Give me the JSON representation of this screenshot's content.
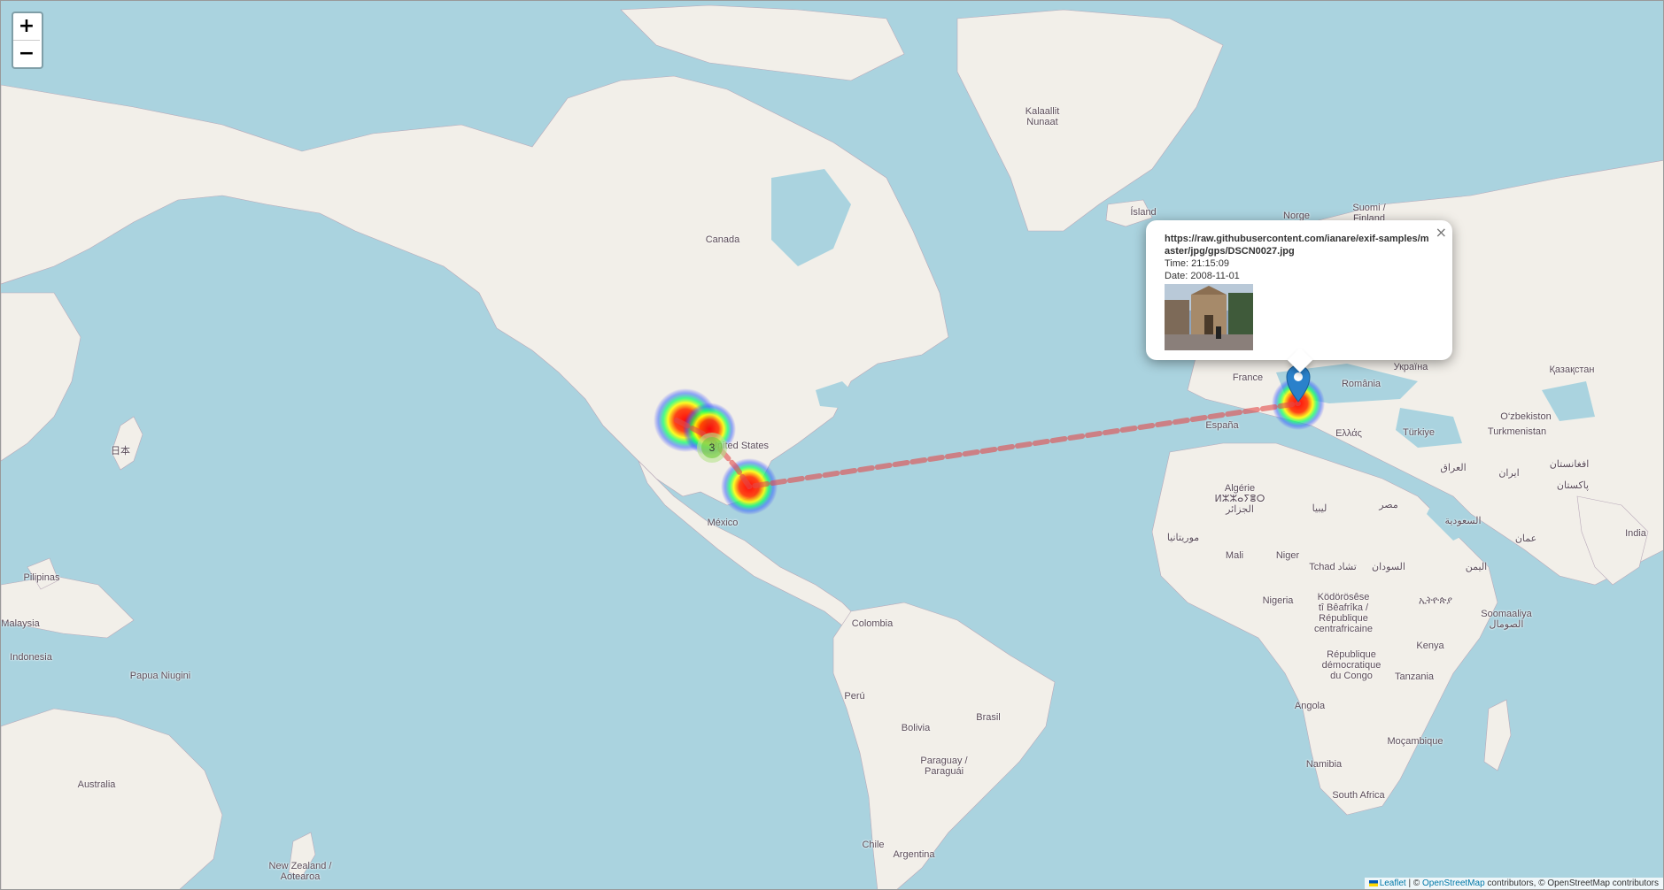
{
  "map": {
    "labels": {
      "greenland": "Kalaallit\nNunaat",
      "canada": "Canada",
      "iceland": "Ísland",
      "norway": "Norge",
      "finland": "Suomi /\nFinland",
      "usa": "United States",
      "mexico": "México",
      "japan": "日本",
      "pilipinas": "Pilipinas",
      "malaysia": "Malaysia",
      "indonesia": "Indonesia",
      "png": "Papua Niugini",
      "australia": "Australia",
      "nz": "New Zealand /\nAotearoa",
      "colombia": "Colombia",
      "peru": "Perú",
      "bolivia": "Bolivia",
      "brasil": "Brasil",
      "paraguay": "Paraguay /\nParaguái",
      "chile": "Chile",
      "argentina": "Argentina",
      "france": "France",
      "espana": "España",
      "romania": "România",
      "ukraine": "Україна",
      "kazakhstan": "Қазақстан",
      "uzbekistan": "O‘zbekiston",
      "turkmenistan": "Turkmenistan",
      "turkiye": "Türkiye",
      "greece": "Ελλάς",
      "iraq": "العراق",
      "iran": "ایران",
      "afghanistan": "افغانستان",
      "pakistan": "پاکستان",
      "india": "India",
      "saudi": "السعودية",
      "oman": "عمان",
      "yemen": "اليمن",
      "egypt": "مصر",
      "libya": "ليبيا",
      "algeria": "Algérie\nⵍⵣⵣⴰⵢⴻⵔ\nالجزائر",
      "mauritania": "موريتانيا",
      "mali": "Mali",
      "niger": "Niger",
      "chad": "Tchad تشاد",
      "sudan": "السودان",
      "ethiopia": "ኢትዮጵያ",
      "somalia": "Soomaaliya\nالصومال",
      "nigeria": "Nigeria",
      "car": "Ködörösêse\ntî Bêafrîka /\nRépublique\ncentrafricaine",
      "drc": "République\ndémocratique\ndu Congo",
      "kenya": "Kenya",
      "tanzania": "Tanzania",
      "angola": "Angola",
      "mozambique": "Moçambique",
      "namibia": "Namibia",
      "southafrica": "South Africa"
    },
    "cluster_count": "3",
    "route_color": "#e34a4a",
    "marker_color": "#2a81cb"
  },
  "zoom": {
    "in": "+",
    "out": "−"
  },
  "popup": {
    "url": "https://raw.githubusercontent.com/ianare/exif-samples/master/jpg/gps/DSCN0027.jpg",
    "time": "Time: 21:15:09",
    "date": "Date: 2008-11-01",
    "close": "×"
  },
  "attribution": {
    "leaflet": "Leaflet",
    "sep": " | © ",
    "osm": "OpenStreetMap",
    "rest": " contributors, © OpenStreetMap contributors"
  }
}
